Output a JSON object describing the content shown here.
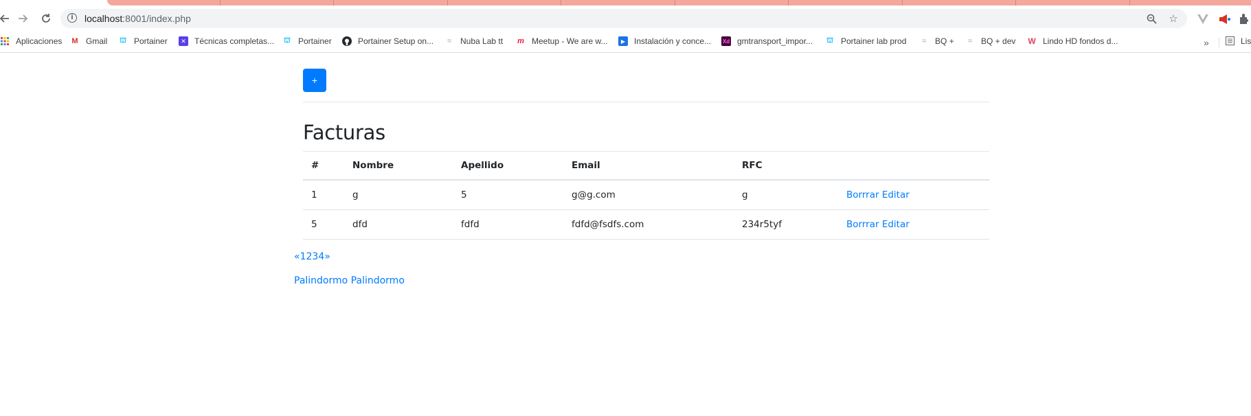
{
  "browser": {
    "url_host": "localhost",
    "url_rest": ":8001/index.php",
    "bookmarks": [
      {
        "label": "Aplicaciones",
        "icon": "apps-grid-icon",
        "color": "#4285f4"
      },
      {
        "label": "Gmail",
        "icon": "gmail-icon",
        "color": "#d93025"
      },
      {
        "label": "Portainer",
        "icon": "portainer-icon",
        "color": "#13bef9"
      },
      {
        "label": "Técnicas completas...",
        "icon": "bookmark-icon",
        "color": "#5b3ee8"
      },
      {
        "label": "Portainer",
        "icon": "portainer-icon",
        "color": "#13bef9"
      },
      {
        "label": "Portainer Setup on...",
        "icon": "github-icon",
        "color": "#24292e"
      },
      {
        "label": "Nuba Lab tt",
        "icon": "cloud-icon",
        "color": "#9aa0a6"
      },
      {
        "label": "Meetup - We are w...",
        "icon": "meetup-icon",
        "color": "#ed1c40"
      },
      {
        "label": "Instalación y conce...",
        "icon": "video-icon",
        "color": "#1a73e8"
      },
      {
        "label": "gmtransport_impor...",
        "icon": "xd-icon",
        "color": "#470137"
      },
      {
        "label": "Portainer lab prod",
        "icon": "portainer-icon",
        "color": "#13bef9"
      },
      {
        "label": "BQ +",
        "icon": "cloud-icon",
        "color": "#9aa0a6"
      },
      {
        "label": "BQ + dev",
        "icon": "cloud-icon",
        "color": "#9aa0a6"
      },
      {
        "label": "Lindo HD fondos d...",
        "icon": "w-logo-icon",
        "color": "#e4405f"
      }
    ],
    "more_label": "»",
    "list_label": "Lis"
  },
  "page": {
    "add_label": "+",
    "title": "Facturas",
    "columns": [
      "#",
      "Nombre",
      "Apellido",
      "Email",
      "RFC",
      ""
    ],
    "rows": [
      {
        "id": "1",
        "nombre": "g",
        "apellido": "5",
        "email": "g@g.com",
        "rfc": "g",
        "delete_label": "Borrrar",
        "edit_label": "Editar"
      },
      {
        "id": "5",
        "nombre": "dfd",
        "apellido": "fdfd",
        "email": "fdfd@fsdfs.com",
        "rfc": "234r5tyf",
        "delete_label": "Borrrar",
        "edit_label": "Editar"
      }
    ],
    "pagination": [
      "«",
      "1",
      "2",
      "3",
      "4",
      "»"
    ],
    "footer_links": [
      "Palindormo",
      "Palindormo"
    ]
  },
  "colors": {
    "primary": "#007bff",
    "tab_strip": "#f4a89d"
  }
}
